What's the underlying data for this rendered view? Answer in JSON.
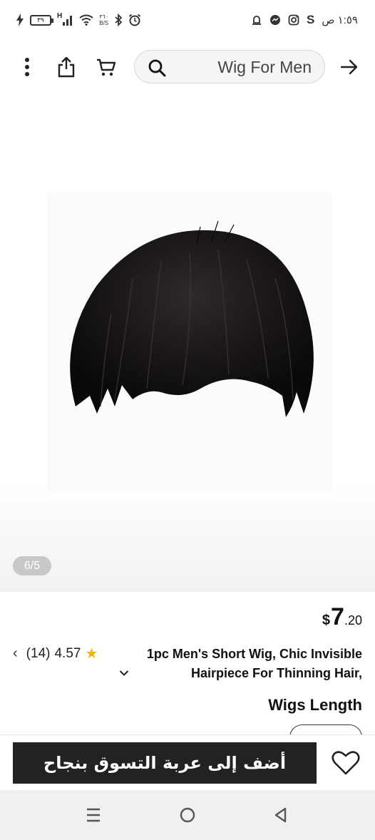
{
  "status_bar": {
    "battery_level": "٣٩",
    "network_type": "H",
    "speed_value": "٣٦٠",
    "speed_unit": "B/S",
    "time": "١:٥٩ ص",
    "app_letter": "S"
  },
  "toolbar": {
    "search_value": "Wig For Men"
  },
  "gallery": {
    "counter": "6/5"
  },
  "product": {
    "price_currency": "$",
    "price_integer": "7",
    "price_decimal": ".20",
    "rating_value": "4.57",
    "review_count": "(14)",
    "title_line1": "1pc Men's Short Wig, Chic Invisible",
    "title_line2": "Hairpiece For Thinning Hair,",
    "option_label": "Wigs Length"
  },
  "actions": {
    "add_to_cart_label": "أضف إلى عربة التسوق بنجاح"
  },
  "colors": {
    "button_bg": "#222222",
    "star": "#f5b400",
    "pill_bg": "#c8c8c8"
  }
}
